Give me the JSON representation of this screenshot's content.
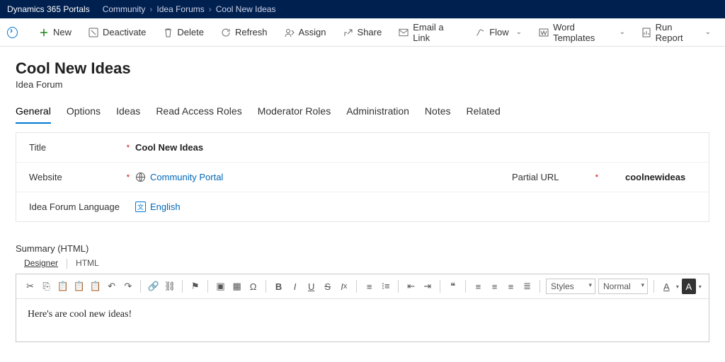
{
  "header": {
    "appname": "Dynamics 365 Portals",
    "breadcrumbs": [
      "Community",
      "Idea Forums",
      "Cool New Ideas"
    ]
  },
  "commands": {
    "new": "New",
    "deactivate": "Deactivate",
    "delete": "Delete",
    "refresh": "Refresh",
    "assign": "Assign",
    "share": "Share",
    "email": "Email a Link",
    "flow": "Flow",
    "wordtpl": "Word Templates",
    "runrpt": "Run Report"
  },
  "page": {
    "title": "Cool New Ideas",
    "subtitle": "Idea Forum"
  },
  "tabs": [
    "General",
    "Options",
    "Ideas",
    "Read Access Roles",
    "Moderator Roles",
    "Administration",
    "Notes",
    "Related"
  ],
  "form": {
    "title_label": "Title",
    "title_value": "Cool New Ideas",
    "website_label": "Website",
    "website_value": "Community Portal",
    "partial_url_label": "Partial URL",
    "partial_url_value": "coolnewideas",
    "lang_label": "Idea Forum Language",
    "lang_value": "English"
  },
  "summary": {
    "title": "Summary (HTML)",
    "subtabs": {
      "designer": "Designer",
      "html": "HTML"
    },
    "toolbar": {
      "styles": "Styles",
      "format": "Normal"
    },
    "content": "Here's are cool new ideas!"
  }
}
